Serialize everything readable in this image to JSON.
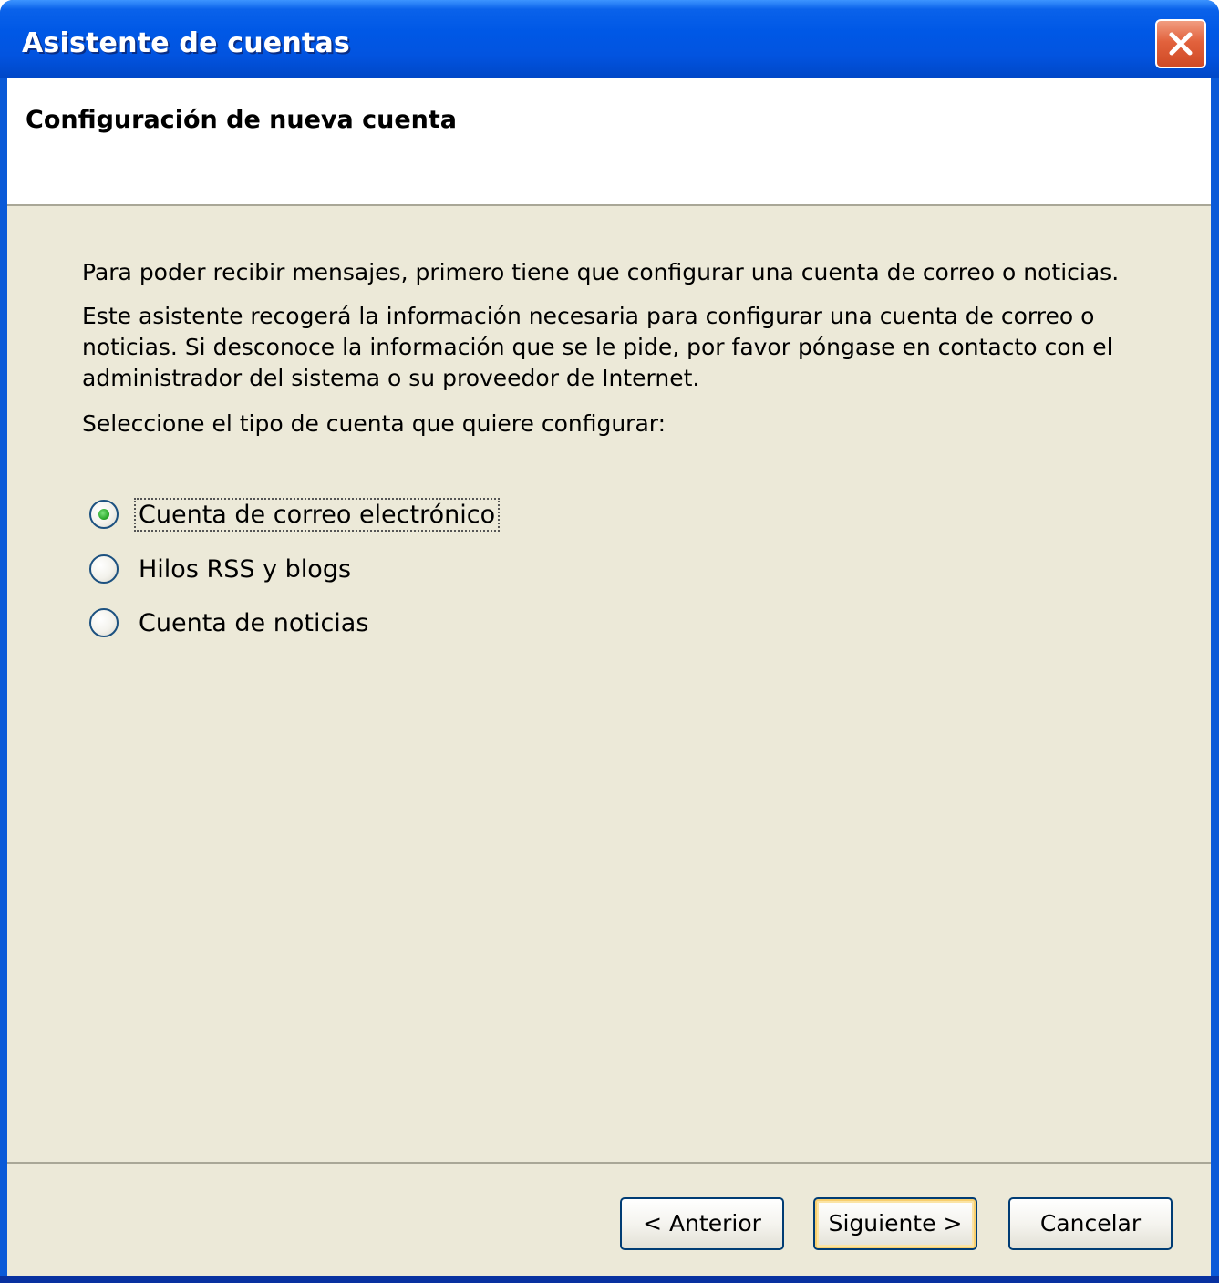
{
  "window": {
    "title": "Asistente de cuentas",
    "close_icon": "close-x-icon"
  },
  "header": {
    "title": "Configuración de nueva cuenta"
  },
  "content": {
    "paragraph_1": "Para poder recibir mensajes, primero tiene que configurar una cuenta de correo o noticias.",
    "paragraph_2": "Este asistente recogerá la información necesaria para configurar una cuenta de correo o noticias. Si desconoce la información que se le pide, por favor póngase en contacto con el administrador del sistema o su proveedor de Internet.",
    "prompt": "Seleccione el tipo de cuenta que quiere configurar:"
  },
  "account_types": {
    "options": [
      {
        "label": "Cuenta de correo electrónico",
        "selected": true
      },
      {
        "label": "Hilos RSS y blogs",
        "selected": false
      },
      {
        "label": "Cuenta de noticias",
        "selected": false
      }
    ]
  },
  "buttons": {
    "previous": "< Anterior",
    "next": "Siguiente >",
    "cancel": "Cancelar"
  },
  "colors": {
    "titlebar": "#0058e6",
    "dialog_background": "#ece9d8",
    "header_background": "#ffffff",
    "close_button": "#e2623d",
    "radio_selected": "#21a121"
  }
}
